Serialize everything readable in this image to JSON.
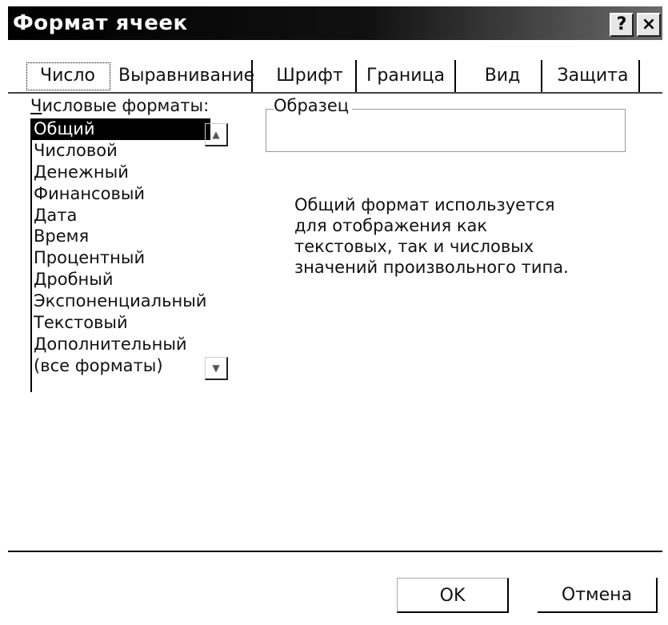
{
  "window": {
    "title": "Формат ячеек",
    "help_button": "?",
    "close_button": "×"
  },
  "tabs": [
    {
      "label": "Число",
      "active": true
    },
    {
      "label": "Выравнивание",
      "active": false
    },
    {
      "label": "Шрифт",
      "active": false
    },
    {
      "label": "Граница",
      "active": false
    },
    {
      "label": "Вид",
      "active": false
    },
    {
      "label": "Защита",
      "active": false
    }
  ],
  "formats": {
    "label_first": "Ч",
    "label_rest": "исловые форматы:",
    "items": [
      "Общий",
      "Числовой",
      "Денежный",
      "Финансовый",
      "Дата",
      "Время",
      "Процентный",
      "Дробный",
      "Экспоненциальный",
      "Текстовый",
      "Дополнительный",
      "(все форматы)"
    ],
    "selected": "Общий"
  },
  "sample": {
    "label": "Образец",
    "value": ""
  },
  "description": "Общий формат используется для отображения как текстовых, так и числовых значений произвольного типа.",
  "buttons": {
    "ok": "OK",
    "cancel": "Отмена"
  },
  "icons": {
    "scroll_up": "triangle-up-icon",
    "scroll_down": "triangle-down-icon"
  }
}
